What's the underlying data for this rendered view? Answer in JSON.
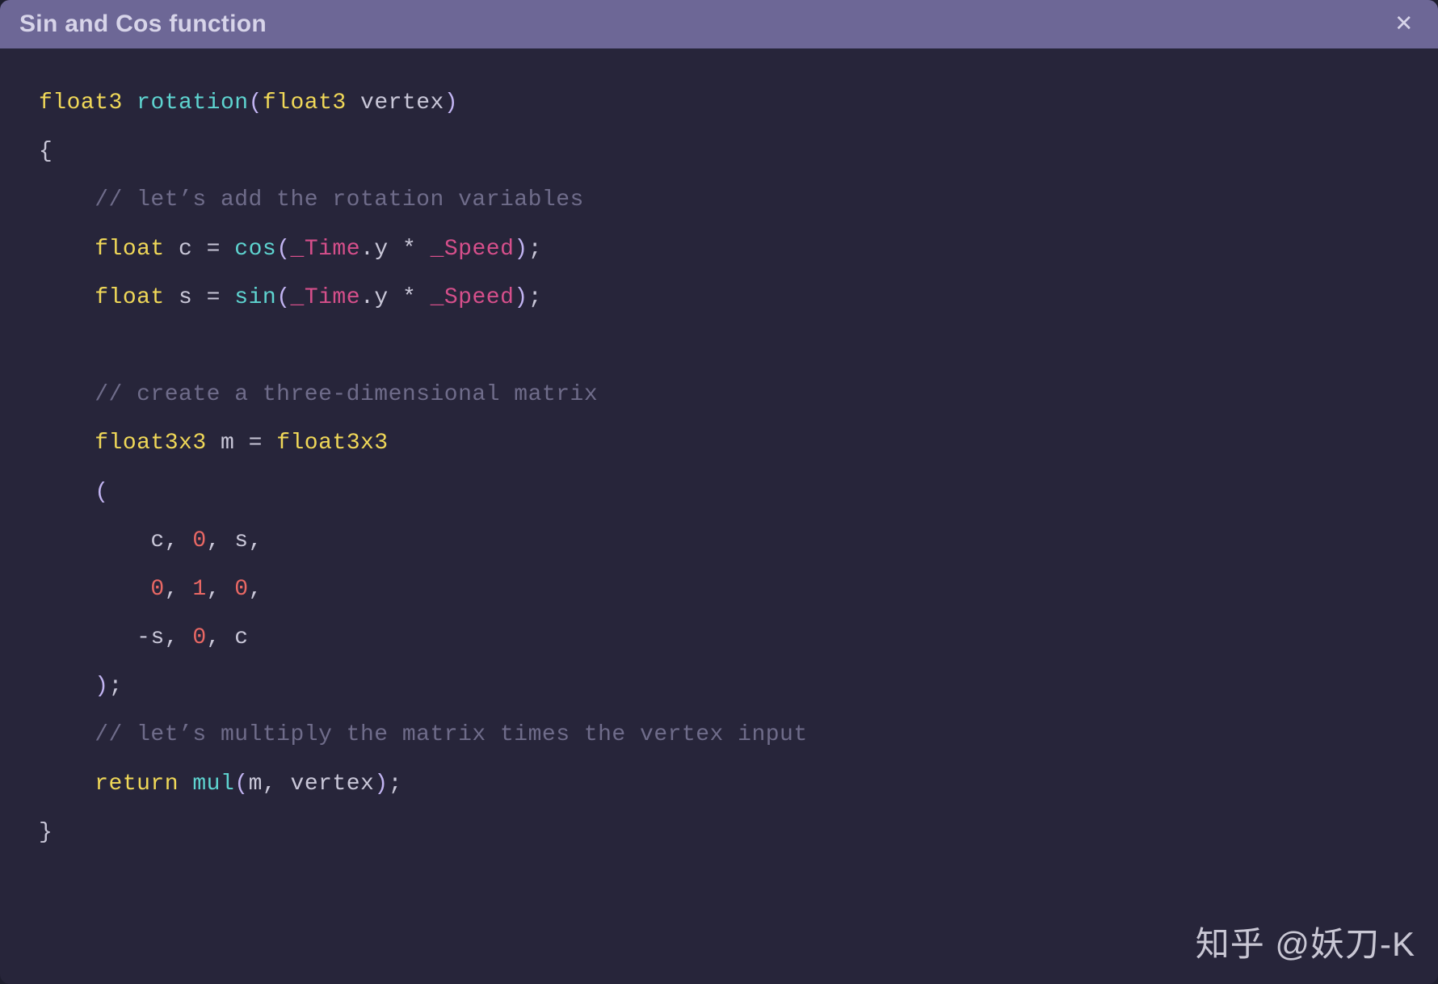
{
  "window": {
    "title": "Sin and Cos function"
  },
  "watermark": "知乎 @妖刀-K",
  "code": {
    "l1_type": "float3",
    "l1_func": "rotation",
    "l1_lp": "(",
    "l1_ptype": "float3",
    "l1_pname": "vertex",
    "l1_rp": ")",
    "l2_brace_open": "{",
    "l3_comment": "// let’s add the rotation variables",
    "l4_type": "float",
    "l4_name": "c",
    "l4_eq": " = ",
    "l4_func": "cos",
    "l4_lp": "(",
    "l4_var1": "_Time",
    "l4_dot_y": ".y",
    "l4_op": " * ",
    "l4_var2": "_Speed",
    "l4_rp": ")",
    "l4_semi": ";",
    "l5_type": "float",
    "l5_name": "s",
    "l5_eq": " = ",
    "l5_func": "sin",
    "l5_lp": "(",
    "l5_var1": "_Time",
    "l5_dot_y": ".y",
    "l5_op": " * ",
    "l5_var2": "_Speed",
    "l5_rp": ")",
    "l5_semi": ";",
    "l6_comment": "// create a three-dimensional matrix",
    "l7_type": "float3x3",
    "l7_name": "m",
    "l7_eq": " = ",
    "l7_ctor": "float3x3",
    "l8_lp": "(",
    "l9_c": "c",
    "l9_sep0": ", ",
    "l9_n0": "0",
    "l9_sep1": ", ",
    "l9_s": "s",
    "l9_sep2": ",",
    "l10_n0": "0",
    "l10_sep0": ", ",
    "l10_n1": "1",
    "l10_sep1": ", ",
    "l10_n2": "0",
    "l10_sep2": ",",
    "l11_minus": "-",
    "l11_s": "s",
    "l11_sep0": ", ",
    "l11_n0": "0",
    "l11_sep1": ", ",
    "l11_c": "c",
    "l12_rp": ")",
    "l12_semi": ";",
    "l13_comment": "// let’s multiply the matrix times the vertex input",
    "l14_return": "return",
    "l14_func": "mul",
    "l14_lp": "(",
    "l14_arg1": "m",
    "l14_sep": ", ",
    "l14_arg2": "vertex",
    "l14_rp": ")",
    "l14_semi": ";",
    "l15_brace_close": "}"
  }
}
